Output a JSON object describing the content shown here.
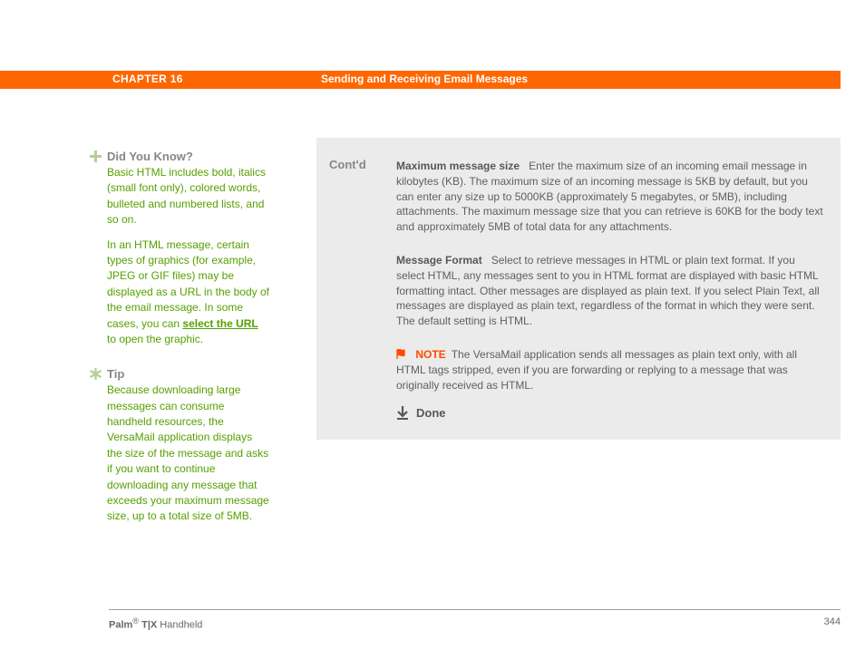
{
  "header": {
    "chapter": "CHAPTER 16",
    "section": "Sending and Receiving Email Messages"
  },
  "sidebar": {
    "dyk": {
      "title": "Did You Know?",
      "p1": "Basic HTML includes bold, italics (small font only), colored words, bulleted and numbered lists, and so on.",
      "p2a": "In an HTML message, certain types of graphics (for example, JPEG or GIF files) may be displayed as a URL in the body of the email message. In some cases, you can ",
      "p2link": "select the URL",
      "p2b": " to open the graphic."
    },
    "tip": {
      "title": "Tip",
      "body": "Because downloading large messages can consume handheld resources, the VersaMail application displays the size of the message and asks if you want to continue downloading any message that exceeds your maximum message size, up to a total size of 5MB."
    }
  },
  "main": {
    "contd": "Cont'd",
    "entries": [
      {
        "label": "Maximum message size",
        "text": "Enter the maximum size of an incoming email message in kilobytes (KB). The maximum size of an incoming message is 5KB by default, but you can enter any size up to 5000KB (approximately 5 megabytes, or 5MB), including attachments. The maximum message size that you can retrieve is 60KB for the body text and approximately 5MB of total data for any attachments."
      },
      {
        "label": "Message Format",
        "text": "Select to retrieve messages in HTML or plain text format. If you select HTML, any messages sent to you in HTML format are displayed with basic HTML formatting intact. Other messages are displayed as plain text. If you select Plain Text, all messages are displayed as plain text, regardless of the format in which they were sent. The default setting is HTML."
      }
    ],
    "note": {
      "label": "NOTE",
      "text": "The VersaMail application sends all messages as plain text only, with all HTML tags stripped, even if you are forwarding or replying to a message that was originally received as HTML."
    },
    "done": "Done"
  },
  "footer": {
    "brand_bold": "Palm",
    "reg": "®",
    "model": " T|X",
    "rest": " Handheld",
    "page": "344"
  }
}
